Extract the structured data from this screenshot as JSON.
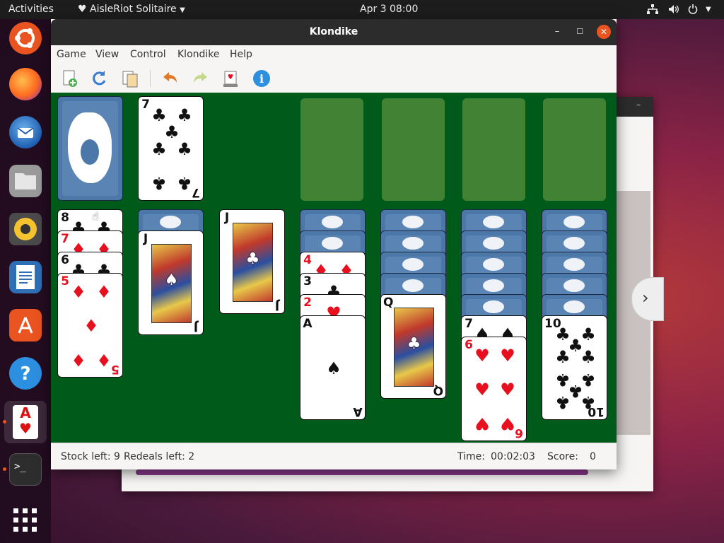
{
  "topbar": {
    "activities": "Activities",
    "app_menu": "AisleRiot Solitaire",
    "clock": "Apr 3  08:00"
  },
  "window": {
    "title": "Klondike",
    "minimize": "–",
    "maximize": "☐",
    "close": "✕"
  },
  "menubar": {
    "items": [
      "Game",
      "View",
      "Control",
      "Klondike",
      "Help"
    ]
  },
  "toolbar": {
    "icons": [
      "new-game-icon",
      "restart-icon",
      "select-game-icon",
      "undo-icon",
      "redo-icon",
      "hint-icon",
      "info-icon"
    ]
  },
  "table": {
    "suit_glyphs": {
      "clubs": "♣",
      "spades": "♠",
      "hearts": "♥",
      "diamonds": "♦"
    },
    "waste": {
      "rank": "7",
      "suit": "clubs"
    },
    "foundations_empty": 4,
    "tableau": [
      {
        "face_down": 0,
        "face_up": [
          {
            "rank": "8",
            "suit": "clubs"
          },
          {
            "rank": "7",
            "suit": "diamonds"
          },
          {
            "rank": "6",
            "suit": "clubs"
          },
          {
            "rank": "5",
            "suit": "diamonds"
          }
        ]
      },
      {
        "face_down": 1,
        "face_up": [
          {
            "rank": "J",
            "suit": "spades"
          }
        ]
      },
      {
        "face_down": 0,
        "face_up": [
          {
            "rank": "J",
            "suit": "clubs"
          }
        ]
      },
      {
        "face_down": 2,
        "face_up": [
          {
            "rank": "4",
            "suit": "diamonds"
          },
          {
            "rank": "3",
            "suit": "clubs"
          },
          {
            "rank": "2",
            "suit": "hearts"
          },
          {
            "rank": "A",
            "suit": "spades"
          }
        ]
      },
      {
        "face_down": 4,
        "face_up": [
          {
            "rank": "Q",
            "suit": "clubs"
          }
        ]
      },
      {
        "face_down": 5,
        "face_up": [
          {
            "rank": "7",
            "suit": "spades"
          },
          {
            "rank": "6",
            "suit": "hearts"
          }
        ]
      },
      {
        "face_down": 5,
        "face_up": [
          {
            "rank": "10",
            "suit": "clubs"
          }
        ]
      }
    ]
  },
  "status": {
    "stock_left": "Stock left: 9",
    "redeals_left": "Redeals left: 2",
    "time_label": "Time:",
    "time_value": "00:02:03",
    "score_label": "Score:",
    "score_value": "0"
  },
  "colors": {
    "felt": "#005a1a",
    "card_back": "#4b78a8",
    "red_suit": "#e8101e",
    "accent": "#e95420"
  }
}
